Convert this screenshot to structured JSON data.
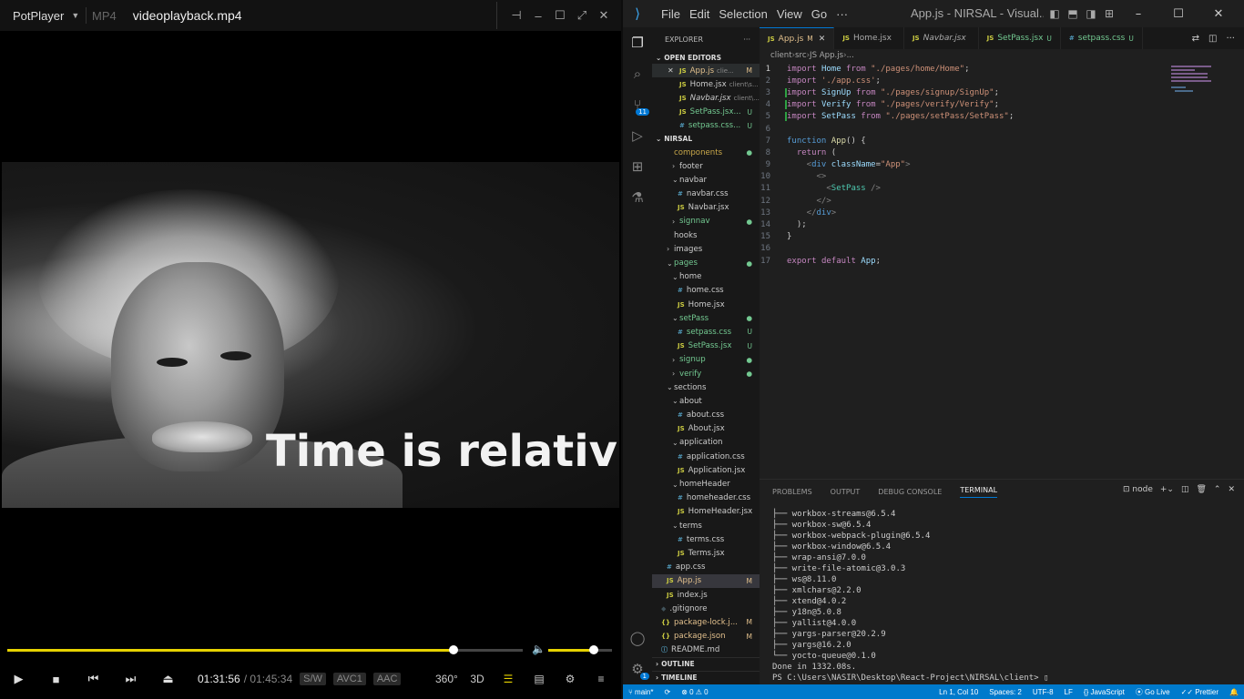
{
  "potplayer": {
    "brand": "PotPlayer",
    "format": "MP4",
    "filename": "videoplayback.mp4",
    "caption": "Time is relative",
    "progress_percent": 86.6,
    "volume_percent": 72,
    "time_current": "01:31:56",
    "time_separator": "/",
    "time_total": "01:45:34",
    "tag_sw": "S/W",
    "tag_video": "AVC1",
    "tag_audio": "AAC",
    "label_360": "360°",
    "label_3d": "3D",
    "accent": "#e6d200"
  },
  "vscode": {
    "menu": [
      "File",
      "Edit",
      "Selection",
      "View",
      "Go",
      "···"
    ],
    "window_title": "App.js - NIRSAL - Visual...",
    "activity_badge_scm": "11",
    "activity_badge_settings": "1",
    "explorer_title": "EXPLORER",
    "explorer_more": "···",
    "open_editors_title": "OPEN EDITORS",
    "open_editors": [
      {
        "icon": "JS",
        "name": "App.js",
        "path": "clie...",
        "status": "M",
        "close": "✕"
      },
      {
        "icon": "JS",
        "name": "Home.jsx",
        "path": "client\\s...",
        "status": ""
      },
      {
        "icon": "JS",
        "name": "Navbar.jsx",
        "path": "client\\...",
        "status": ""
      },
      {
        "icon": "JS",
        "name": "SetPass.jsx...",
        "path": "",
        "status": "U"
      },
      {
        "icon": "#",
        "name": "setpass.css...",
        "path": "",
        "status": "U"
      }
    ],
    "project_title": "NIRSAL",
    "tree": [
      {
        "depth": 1,
        "arrow": "",
        "icon": "",
        "name": "components",
        "status": "●",
        "color": "#c9a84a"
      },
      {
        "depth": 2,
        "arrow": "›",
        "icon": "",
        "name": "footer",
        "status": "",
        "color": "#ccc"
      },
      {
        "depth": 2,
        "arrow": "⌄",
        "icon": "",
        "name": "navbar",
        "status": "",
        "color": "#ccc"
      },
      {
        "depth": 3,
        "arrow": "",
        "icon": "#",
        "name": "navbar.css",
        "status": "",
        "color": "#ccc"
      },
      {
        "depth": 3,
        "arrow": "",
        "icon": "JS",
        "name": "Navbar.jsx",
        "status": "",
        "color": "#ccc"
      },
      {
        "depth": 2,
        "arrow": "›",
        "icon": "",
        "name": "signnav",
        "status": "●",
        "color": "#73c991"
      },
      {
        "depth": 1,
        "arrow": "",
        "icon": "",
        "name": "hooks",
        "status": "",
        "color": "#ccc"
      },
      {
        "depth": 1,
        "arrow": "›",
        "icon": "",
        "name": "images",
        "status": "",
        "color": "#ccc"
      },
      {
        "depth": 1,
        "arrow": "⌄",
        "icon": "",
        "name": "pages",
        "status": "●",
        "color": "#73c991"
      },
      {
        "depth": 2,
        "arrow": "⌄",
        "icon": "",
        "name": "home",
        "status": "",
        "color": "#ccc"
      },
      {
        "depth": 3,
        "arrow": "",
        "icon": "#",
        "name": "home.css",
        "status": "",
        "color": "#ccc"
      },
      {
        "depth": 3,
        "arrow": "",
        "icon": "JS",
        "name": "Home.jsx",
        "status": "",
        "color": "#ccc"
      },
      {
        "depth": 2,
        "arrow": "⌄",
        "icon": "",
        "name": "setPass",
        "status": "●",
        "color": "#73c991"
      },
      {
        "depth": 3,
        "arrow": "",
        "icon": "#",
        "name": "setpass.css",
        "status": "U",
        "color": "#73c991"
      },
      {
        "depth": 3,
        "arrow": "",
        "icon": "JS",
        "name": "SetPass.jsx",
        "status": "U",
        "color": "#73c991"
      },
      {
        "depth": 2,
        "arrow": "›",
        "icon": "",
        "name": "signup",
        "status": "●",
        "color": "#73c991"
      },
      {
        "depth": 2,
        "arrow": "›",
        "icon": "",
        "name": "verify",
        "status": "●",
        "color": "#73c991"
      },
      {
        "depth": 1,
        "arrow": "⌄",
        "icon": "",
        "name": "sections",
        "status": "",
        "color": "#ccc"
      },
      {
        "depth": 2,
        "arrow": "⌄",
        "icon": "",
        "name": "about",
        "status": "",
        "color": "#ccc"
      },
      {
        "depth": 3,
        "arrow": "",
        "icon": "#",
        "name": "about.css",
        "status": "",
        "color": "#ccc"
      },
      {
        "depth": 3,
        "arrow": "",
        "icon": "JS",
        "name": "About.jsx",
        "status": "",
        "color": "#ccc"
      },
      {
        "depth": 2,
        "arrow": "⌄",
        "icon": "",
        "name": "application",
        "status": "",
        "color": "#ccc"
      },
      {
        "depth": 3,
        "arrow": "",
        "icon": "#",
        "name": "application.css",
        "status": "",
        "color": "#ccc"
      },
      {
        "depth": 3,
        "arrow": "",
        "icon": "JS",
        "name": "Application.jsx",
        "status": "",
        "color": "#ccc"
      },
      {
        "depth": 2,
        "arrow": "⌄",
        "icon": "",
        "name": "homeHeader",
        "status": "",
        "color": "#ccc"
      },
      {
        "depth": 3,
        "arrow": "",
        "icon": "#",
        "name": "homeheader.css",
        "status": "",
        "color": "#ccc"
      },
      {
        "depth": 3,
        "arrow": "",
        "icon": "JS",
        "name": "HomeHeader.jsx",
        "status": "",
        "color": "#ccc"
      },
      {
        "depth": 2,
        "arrow": "⌄",
        "icon": "",
        "name": "terms",
        "status": "",
        "color": "#ccc"
      },
      {
        "depth": 3,
        "arrow": "",
        "icon": "#",
        "name": "terms.css",
        "status": "",
        "color": "#ccc"
      },
      {
        "depth": 3,
        "arrow": "",
        "icon": "JS",
        "name": "Terms.jsx",
        "status": "",
        "color": "#ccc"
      },
      {
        "depth": 1,
        "arrow": "",
        "icon": "#",
        "name": "app.css",
        "status": "",
        "color": "#ccc"
      },
      {
        "depth": 1,
        "arrow": "",
        "icon": "JS",
        "name": "App.js",
        "status": "M",
        "color": "#e2c08d"
      },
      {
        "depth": 1,
        "arrow": "",
        "icon": "JS",
        "name": "index.js",
        "status": "",
        "color": "#ccc"
      },
      {
        "depth": 0,
        "arrow": "",
        "icon": "◆",
        "name": ".gitignore",
        "status": "",
        "color": "#ccc"
      },
      {
        "depth": 0,
        "arrow": "",
        "icon": "{}",
        "name": "package-lock.j...",
        "status": "M",
        "color": "#e2c08d"
      },
      {
        "depth": 0,
        "arrow": "",
        "icon": "{}",
        "name": "package.json",
        "status": "M",
        "color": "#e2c08d"
      },
      {
        "depth": 0,
        "arrow": "",
        "icon": "ⓘ",
        "name": "README.md",
        "status": "",
        "color": "#ccc"
      }
    ],
    "outline_title": "OUTLINE",
    "timeline_title": "TIMELINE",
    "tabs": [
      {
        "icon": "JS",
        "name": "App.js",
        "status": "M",
        "active": true
      },
      {
        "icon": "JS",
        "name": "Home.jsx",
        "status": "",
        "active": false
      },
      {
        "icon": "JS",
        "name": "Navbar.jsx",
        "status": "",
        "active": false
      },
      {
        "icon": "JS",
        "name": "SetPass.jsx",
        "status": "U",
        "active": false
      },
      {
        "icon": "#",
        "name": "setpass.css",
        "status": "U",
        "active": false
      }
    ],
    "breadcrumb": [
      "client",
      "src",
      "JS App.js",
      "..."
    ],
    "code": [
      [
        [
          "import ",
          "#c586c0"
        ],
        [
          "Home ",
          "#9cdcfe"
        ],
        [
          "from ",
          "#c586c0"
        ],
        [
          "\"./pages/home/Home\"",
          "#ce9178"
        ],
        [
          ";",
          "#ccc"
        ]
      ],
      [
        [
          "import ",
          "#c586c0"
        ],
        [
          "'./app.css'",
          "#ce9178"
        ],
        [
          ";",
          "#ccc"
        ]
      ],
      [
        [
          "import ",
          "#c586c0"
        ],
        [
          "SignUp ",
          "#9cdcfe"
        ],
        [
          "from ",
          "#c586c0"
        ],
        [
          "\"./pages/signup/SignUp\"",
          "#ce9178"
        ],
        [
          ";",
          "#ccc"
        ]
      ],
      [
        [
          "import ",
          "#c586c0"
        ],
        [
          "Verify ",
          "#9cdcfe"
        ],
        [
          "from ",
          "#c586c0"
        ],
        [
          "\"./pages/verify/Verify\"",
          "#ce9178"
        ],
        [
          ";",
          "#ccc"
        ]
      ],
      [
        [
          "import ",
          "#c586c0"
        ],
        [
          "SetPass ",
          "#9cdcfe"
        ],
        [
          "from ",
          "#c586c0"
        ],
        [
          "\"./pages/setPass/SetPass\"",
          "#ce9178"
        ],
        [
          ";",
          "#ccc"
        ]
      ],
      [],
      [
        [
          "function ",
          "#569cd6"
        ],
        [
          "App",
          "#dcdcaa"
        ],
        [
          "() {",
          "#ccc"
        ]
      ],
      [
        [
          "  return ",
          "#c586c0"
        ],
        [
          "(",
          "#ccc"
        ]
      ],
      [
        [
          "    <",
          "#808080"
        ],
        [
          "div ",
          "#569cd6"
        ],
        [
          "className",
          "#9cdcfe"
        ],
        [
          "=",
          "#ccc"
        ],
        [
          "\"App\"",
          "#ce9178"
        ],
        [
          ">",
          "#808080"
        ]
      ],
      [
        [
          "      <>",
          "#808080"
        ]
      ],
      [
        [
          "        <",
          "#808080"
        ],
        [
          "SetPass ",
          "#4ec9b0"
        ],
        [
          "/>",
          "#808080"
        ]
      ],
      [
        [
          "      </>",
          "#808080"
        ]
      ],
      [
        [
          "    </",
          "#808080"
        ],
        [
          "div",
          "#569cd6"
        ],
        [
          ">",
          "#808080"
        ]
      ],
      [
        [
          "  );",
          "#ccc"
        ]
      ],
      [
        [
          "}",
          "#ccc"
        ]
      ],
      [],
      [
        [
          "export ",
          "#c586c0"
        ],
        [
          "default ",
          "#c586c0"
        ],
        [
          "App",
          "#9cdcfe"
        ],
        [
          ";",
          "#ccc"
        ]
      ]
    ],
    "current_line": 1,
    "panel_tabs": [
      "PROBLEMS",
      "OUTPUT",
      "DEBUG CONSOLE",
      "TERMINAL"
    ],
    "panel_active": "TERMINAL",
    "terminal_shell": "node",
    "terminal_lines": [
      "├── workbox-streams@6.5.4",
      "├── workbox-sw@6.5.4",
      "├── workbox-webpack-plugin@6.5.4",
      "├── workbox-window@6.5.4",
      "├── wrap-ansi@7.0.0",
      "├── write-file-atomic@3.0.3",
      "├── ws@8.11.0",
      "├── xmlchars@2.2.0",
      "├── xtend@4.0.2",
      "├── y18n@5.0.8",
      "├── yallist@4.0.0",
      "├── yargs-parser@20.2.9",
      "├── yargs@16.2.0",
      "└── yocto-queue@0.1.0",
      "Done in 1332.08s.",
      "PS C:\\Users\\NASIR\\Desktop\\React-Project\\NIRSAL\\client> ▯"
    ],
    "status": {
      "branch": "main*",
      "sync": "⟳",
      "problems": "⊗ 0 ⚠ 0",
      "cursor": "Ln 1, Col 10",
      "spaces": "Spaces: 2",
      "encoding": "UTF-8",
      "eol": "LF",
      "language": "{} JavaScript",
      "golive": "⦿ Go Live",
      "prettier": "✓✓ Prettier",
      "bell": "🔔"
    }
  }
}
